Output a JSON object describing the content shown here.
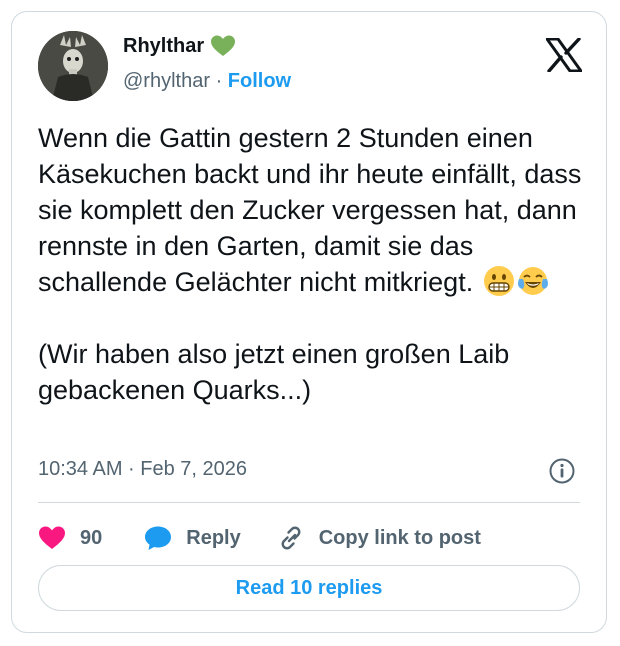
{
  "author": {
    "display_name": "Rhylthar",
    "handle": "@rhylthar",
    "separator": "·",
    "follow_label": "Follow",
    "verified_heart_color": "#78b159"
  },
  "tweet": {
    "text_main": "Wenn die Gattin gestern 2 Stunden einen Käsekuchen backt und ihr heute einfällt, dass sie komplett den Zucker vergessen hat, dann rennste in den Garten, damit sie das schallende Gelächter nicht mitkriegt. ",
    "emojis": [
      "grimacing-face-icon",
      "face-with-tears-of-joy-icon"
    ],
    "text_second": "(Wir haben also jetzt einen großen Laib gebackenen Quarks...)",
    "timestamp": "10:34 AM · Feb 7, 2026"
  },
  "actions": {
    "like_count": "90",
    "reply_label": "Reply",
    "copy_link_label": "Copy link to post",
    "like_color": "#f91880",
    "accent_color": "#1d9bf0"
  },
  "footer": {
    "read_replies_label": "Read 10 replies"
  }
}
